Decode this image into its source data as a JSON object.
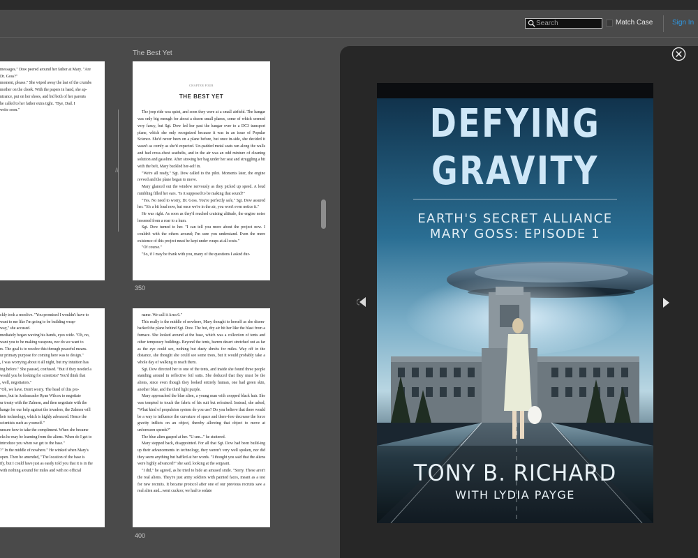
{
  "toolbar": {
    "search_placeholder": "Search",
    "match_case_label": "Match Case",
    "sign_in_label": "Sign In"
  },
  "book": {
    "chapter_heading": "The Best Yet",
    "page_numbers": [
      "350",
      "400"
    ],
    "left_page_1": [
      "messages.\" Dow peered around her father at Mary. \"Are",
      "Dr. Goss?\"",
      "moment, please.\" She wiped away the last of the crumbs",
      "mother on the cheek. With the papers in hand, she ap-",
      "ntrance, put on her shoes, and bid both of her parents",
      "he called to her father extra tight. \"Bye, Dad. I",
      "write soon.\""
    ],
    "right_page_1": {
      "chapter_small": "CHAPTER FOUR",
      "chapter_title": "THE BEST YET",
      "paragraphs": [
        "The jeep ride was quiet, and soon they were at a small airfield. The hangar was only big enough for about a dozen small planes, some of which seemed very fancy, but Sgt. Dow led her past the hangar over to a DC3 transport plane, which she only recognized because it was in an issue of Popular Science. She'd never been on a plane before, but once in-side, she decided it wasn't as comfy as she'd expected. Un-padded metal seats ran along the walls and had cross-chest seatbelts, and in the air was an odd mixture of cleaning solution and gasoline. After stowing her bag under her seat and struggling a bit with the belt, Mary buckled her-self in.",
        "\"We're all ready,\" Sgt. Dow called to the pilot. Moments later, the engine revved and the plane began to move.",
        "Mary glanced out the window nervously as they picked up speed. A loud rumbling filled her ears. \"Is it supposed to be making that sound?\"",
        "\"Yes. No need to worry, Dr. Goss. You're perfectly safe,\" Sgt. Dow assured her. \"It's a bit loud now, but once we're in the air, you won't even notice it.\"",
        "He was right. As soon as they'd reached cruising altitude, the engine noise lessened from a roar to a hum.",
        "Sgt. Dow turned to her. \"I can tell you more about the project now. I couldn't with the others around; I'm sure you understand. Even the mere existence of this project must be kept under wraps at all costs.\"",
        "\"Of course.\"",
        "\"So, if I may be frank with you, many of the questions I asked dur-"
      ]
    },
    "left_page_2": [
      "ckly took a moolive. \"You promised I wouldn't have to",
      "want to me like I'm going to be building weap-",
      "way,\" she accused.",
      "mediately began waving his hands, eyes wide. \"Oh, no,",
      "want you to be making weapons, nor do we want to",
      "rs. The goal is to resolve this through peaceful means.",
      "ur primary purpose for coming here was to design.\"",
      ", I was worrying about it all night, but my intuition has",
      "ing before.\" She paused, confused. \"But if they needed a",
      "would you be looking for scientists? You'd think that",
      ", well, negotiators.\"",
      "\"Oh, we have. Don't worry. The head of this pro-",
      "mes, but in Ambassador Ryan Wilcox to negotiate",
      "ur treaty with the Zalmen, and then negotiate with the",
      "hange for our help against the invaders, the Zalmen will",
      "heir technology, which is highly advanced. Hence the",
      "scientists such as yourself.\"",
      "unsure how to take the compliment. When she became",
      "eks he may be learning from the aliens. When do I get to",
      "",
      "introduce you when we get to the base.\"",
      "?\" In the middle of nowhere.\" He winked when Mary's",
      "open. Then he amended, \"The location of the base is",
      "ify, but I could have just as easily told you that it is in the",
      "with nothing around for miles and with no official"
    ],
    "right_page_2": [
      "name. We call it Area 6.\"",
      "This really is the middle of nowhere, Mary thought to herself as she disem-barked the plane behind Sgt. Dow. The hot, dry air hit her like the blast from a furnace. She looked around at the base, which was a collection of tents and other temporary buildings. Beyond the tents, barren desert stretched out as far as the eye could see, nothing but dusty shrubs for miles. Way off in the distance, she thought she could see some trees, but it would probably take a whole day of walking to reach them.",
      "Sgt. Dow directed her to one of the tents, and inside she found three people standing around in reflective foil suits. She deduced that they must be the aliens, since even though they looked entirely human, one had green skin, another blue, and the third light purple.",
      "Mary approached the blue alien, a young man with cropped black hair. She was tempted to touch the fabric of his suit but refrained. Instead, she asked, \"What kind of propulsion system do you use? Do you believe that there would be a way to influence the curvature of space and there-fore decrease the force gravity inflicts on an object, thereby allowing that object to move at unforeseen speeds?\"",
      "The blue alien gasped at her. \"U-um...\" he stuttered.",
      "Mary stepped back, disappointed. For all that Sgt. Dow had been build-ing up their advancements in technology, they weren't very well spoken, nor did they seem anything but baffled at her words. \"I thought you said that the aliens were highly advanced?\" she said, looking at the sergeant.",
      "\"I did,\" he agreed, as he tried to hide an amused smile. \"Sorry. These aren't the real aliens. They're just army soldiers with painted faces, meant as a test for new recruits. It became protocol after one of our previous recruits saw a real alien and...went cuckoo; we had to sedate"
    ]
  },
  "cover": {
    "title_line_1": "DEFYING",
    "title_line_2": "GRAVITY",
    "series_line_1": "EARTH'S SECRET ALLIANCE",
    "series_line_2": "MARY GOSS: EPISODE 1",
    "author": "TONY B. RICHARD",
    "coauthor": "WITH LYDIA PAYGE"
  }
}
